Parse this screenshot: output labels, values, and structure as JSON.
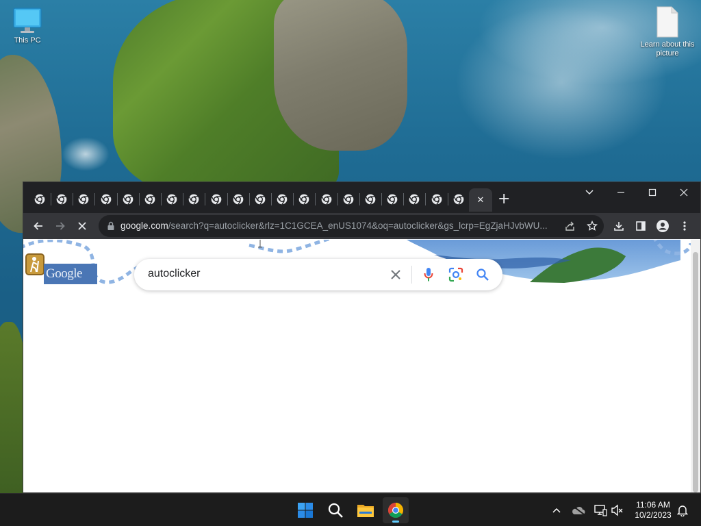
{
  "desktop": {
    "icons": [
      {
        "label": "This PC"
      },
      {
        "label": "Learn about this picture"
      }
    ]
  },
  "browser": {
    "tab_count": 21,
    "active_tab_close": "✕",
    "new_tab": "+",
    "window_controls": {
      "dropdown": "⌵",
      "minimize": "—",
      "maximize": "☐",
      "close": "✕"
    },
    "address": {
      "host": "google.com",
      "path": "/search?q=autoclicker&rlz=1C1GCEA_enUS1074&oq=autoclicker&gs_lcrp=EgZjaHJvbWU..."
    },
    "toolbar_icons": [
      "back-arrow-icon",
      "forward-arrow-icon",
      "stop-icon",
      "lock-icon",
      "share-icon",
      "star-icon",
      "download-icon",
      "side-panel-icon",
      "profile-icon",
      "menu-icon"
    ]
  },
  "page": {
    "logo_text": "Google",
    "search": {
      "query": "autoclicker"
    }
  },
  "taskbar": {
    "apps": [
      "windows-start-icon",
      "search-icon",
      "file-explorer-icon",
      "chrome-icon"
    ],
    "tray_icons": [
      "chevron-up-icon",
      "onedrive-icon",
      "network-icon",
      "volume-muted-icon",
      "notification-bell-icon"
    ],
    "time": "11:06 AM",
    "date": "10/2/2023"
  },
  "colors": {
    "chrome_dark": "#202124",
    "toolbar": "#35363a",
    "taskbar": "#1c1c1c",
    "google_blue": "#4285f4"
  }
}
